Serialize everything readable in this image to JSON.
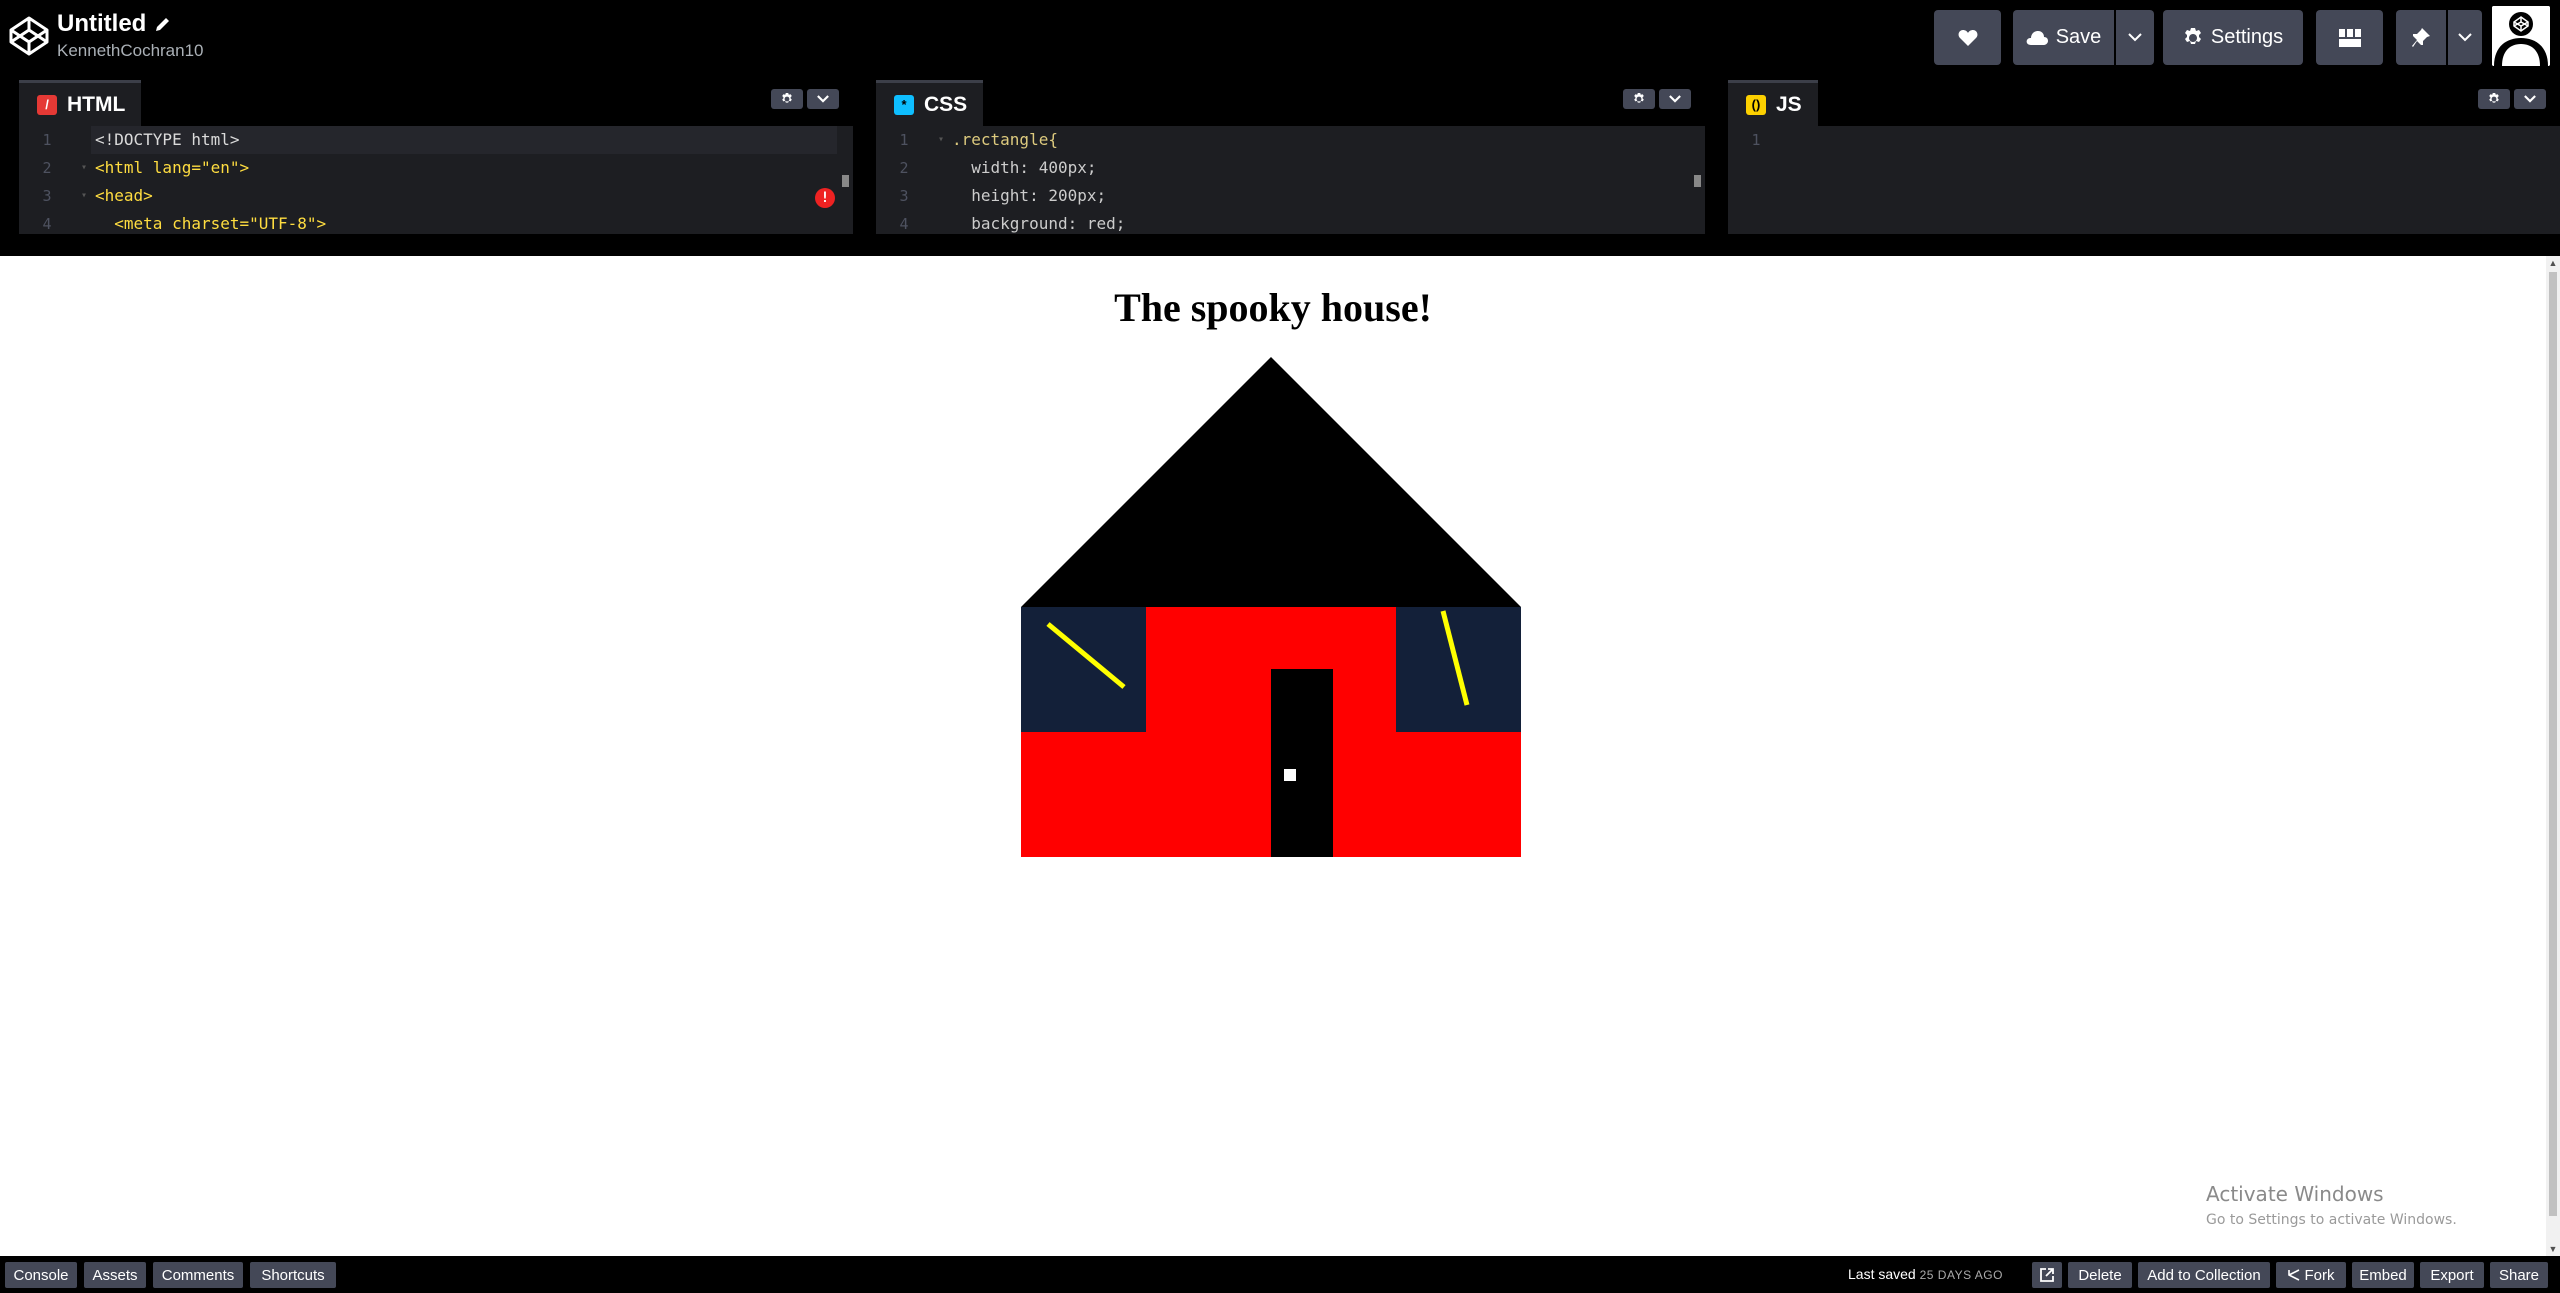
{
  "header": {
    "title": "Untitled",
    "user": "KennethCochran10",
    "save_label": "Save",
    "settings_label": "Settings"
  },
  "editors": {
    "html": {
      "label": "HTML",
      "badge": "/",
      "color": "#e53935",
      "lines": [
        {
          "n": "1",
          "text": "<!DOCTYPE html>"
        },
        {
          "n": "2",
          "text": "<html lang=\"en\">"
        },
        {
          "n": "3",
          "text": "<head>"
        },
        {
          "n": "4",
          "text": "  <meta charset=\"UTF-8\">"
        }
      ]
    },
    "css": {
      "label": "CSS",
      "badge": "*",
      "color": "#0ebeff",
      "lines": [
        {
          "n": "1",
          "text": ".rectangle{"
        },
        {
          "n": "2",
          "text": "  width: 400px;"
        },
        {
          "n": "3",
          "text": "  height: 200px;"
        },
        {
          "n": "4",
          "text": "  background: red;"
        }
      ]
    },
    "js": {
      "label": "JS",
      "badge": "()",
      "color": "#fcd000",
      "lines": [
        {
          "n": "1",
          "text": ""
        }
      ]
    }
  },
  "preview": {
    "heading": "The spooky house!",
    "colors": {
      "roof": "#000000",
      "walls": "#ff0000",
      "windows": "#132039",
      "window_streak": "#ffff00",
      "door": "#000000",
      "knob": "#ffffff"
    }
  },
  "watermark": {
    "line1": "Activate Windows",
    "line2": "Go to Settings to activate Windows."
  },
  "footer": {
    "left_buttons": [
      "Console",
      "Assets",
      "Comments",
      "Shortcuts"
    ],
    "saved_prefix": "Last saved",
    "saved_ago": "25 DAYS AGO",
    "right_buttons": [
      "Delete",
      "Add to Collection",
      "Fork",
      "Embed",
      "Export",
      "Share"
    ]
  }
}
